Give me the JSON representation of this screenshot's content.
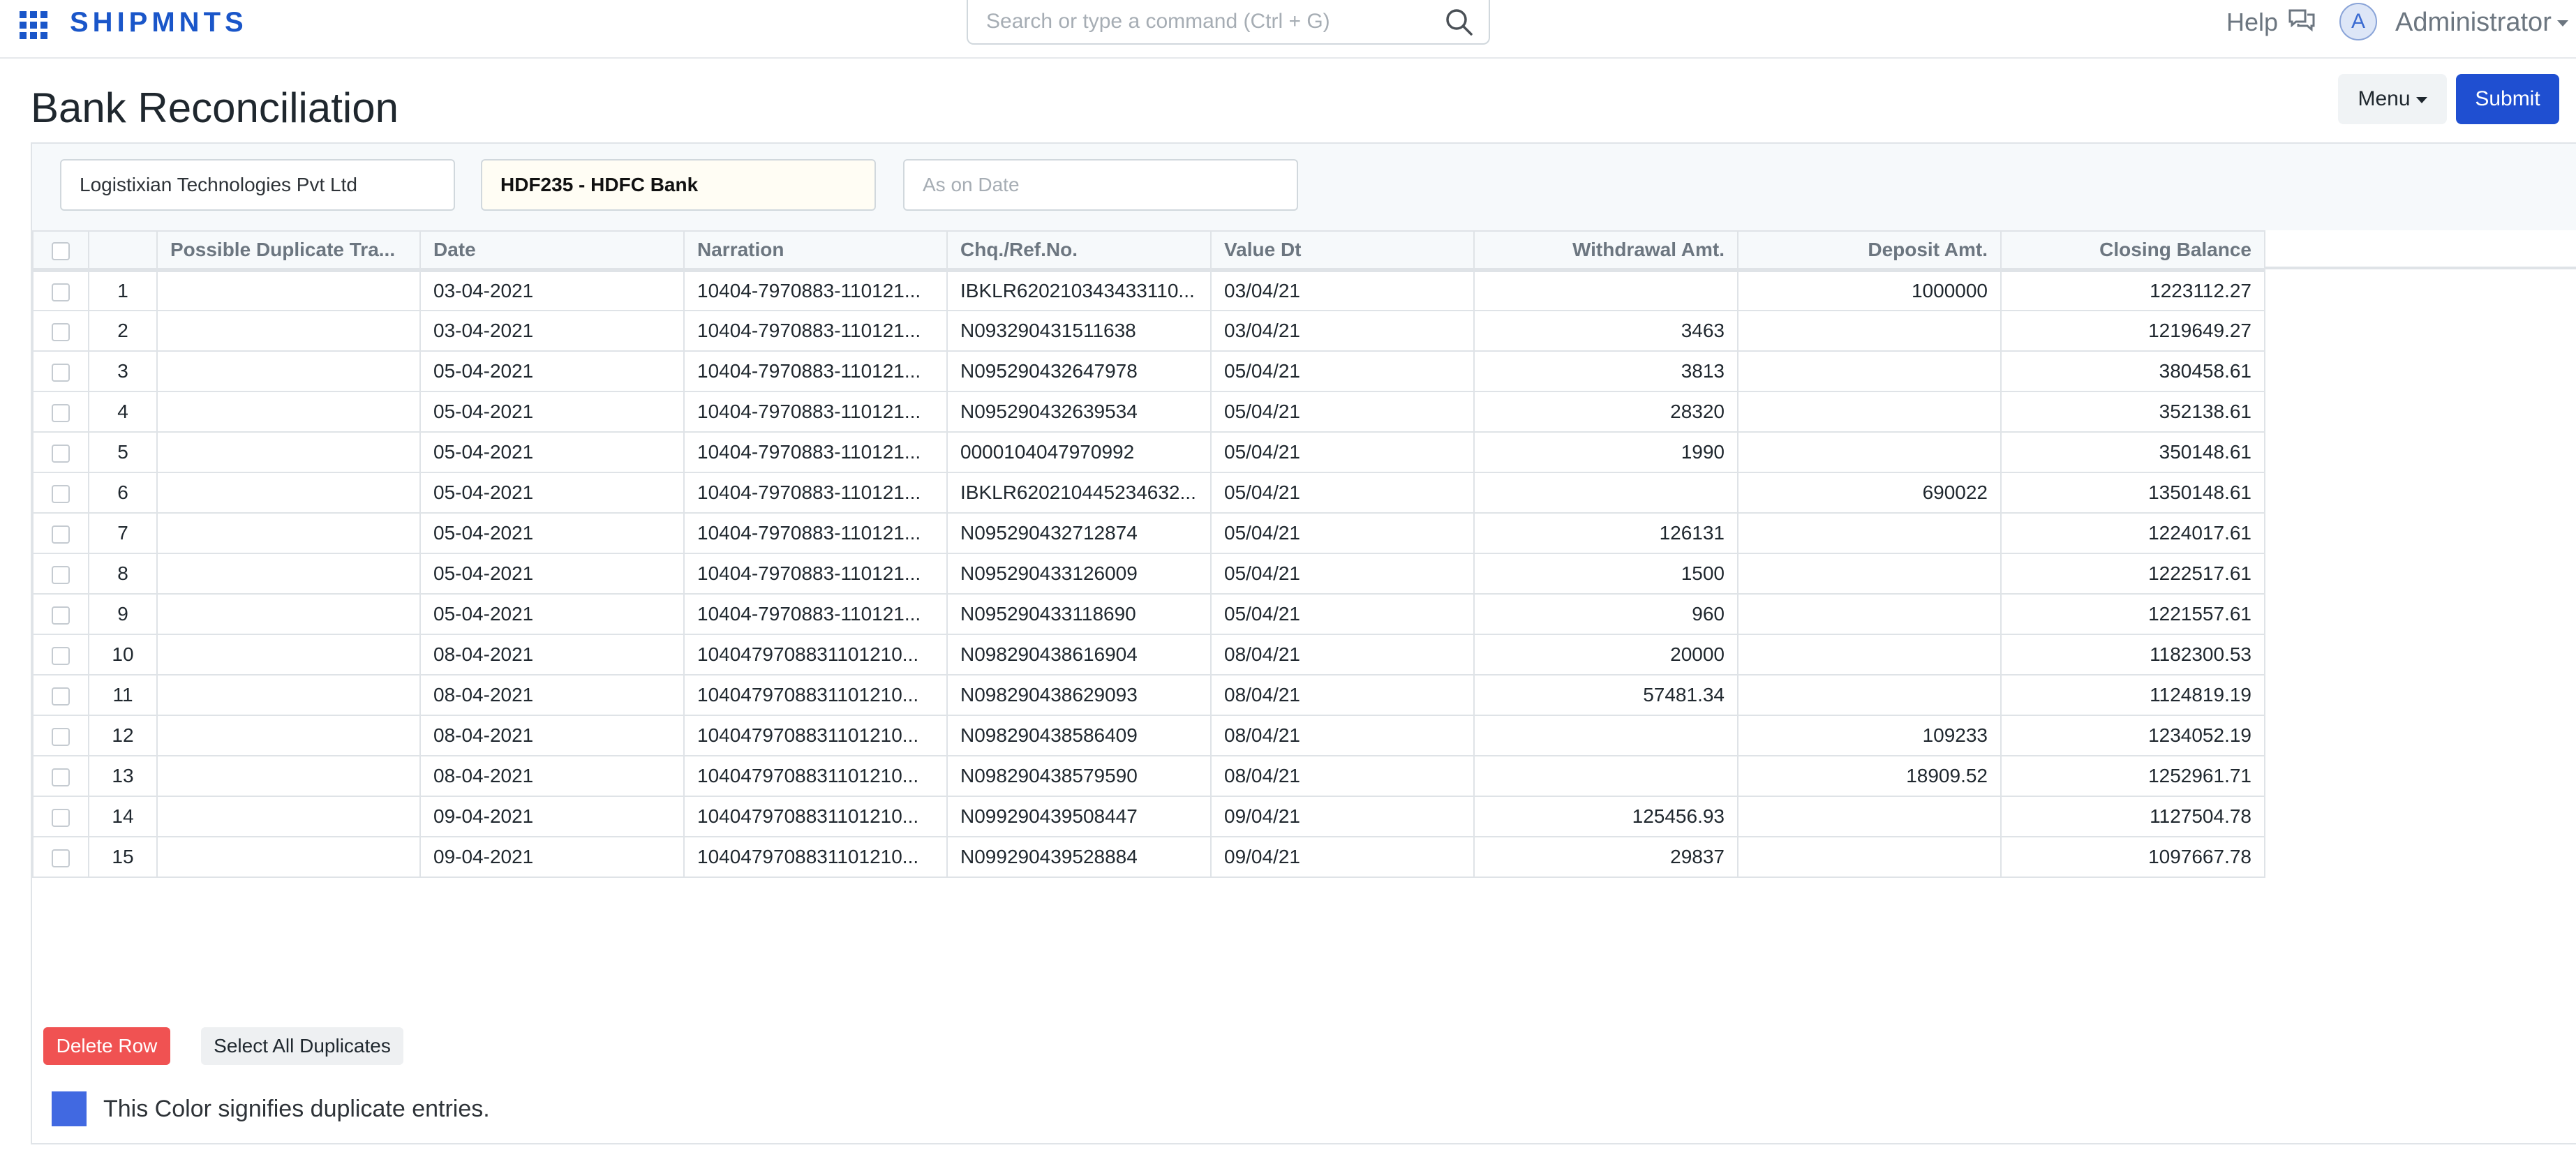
{
  "navbar": {
    "brand": "SHIPMNTS",
    "search_placeholder": "Search or type a command (Ctrl + G)",
    "help_label": "Help",
    "avatar_initial": "A",
    "user_name": "Administrator"
  },
  "page": {
    "title": "Bank Reconciliation",
    "menu_label": "Menu",
    "submit_label": "Submit"
  },
  "filters": {
    "company": "Logistixian Technologies Pvt Ltd",
    "bank_account": "HDF235 - HDFC Bank",
    "date_placeholder": "As on Date"
  },
  "table": {
    "columns": [
      "Possible Duplicate Tra...",
      "Date",
      "Narration",
      "Chq./Ref.No.",
      "Value Dt",
      "Withdrawal Amt.",
      "Deposit Amt.",
      "Closing Balance"
    ],
    "rows": [
      {
        "idx": "1",
        "dup": "",
        "date": "03-04-2021",
        "narration": "10404-7970883-110121...",
        "ref": "IBKLR620210343433110...",
        "value_dt": "03/04/21",
        "withdrawal": "",
        "deposit": "1000000",
        "balance": "1223112.27"
      },
      {
        "idx": "2",
        "dup": "",
        "date": "03-04-2021",
        "narration": "10404-7970883-110121...",
        "ref": "N093290431511638",
        "value_dt": "03/04/21",
        "withdrawal": "3463",
        "deposit": "",
        "balance": "1219649.27"
      },
      {
        "idx": "3",
        "dup": "",
        "date": "05-04-2021",
        "narration": "10404-7970883-110121...",
        "ref": "N095290432647978",
        "value_dt": "05/04/21",
        "withdrawal": "3813",
        "deposit": "",
        "balance": "380458.61"
      },
      {
        "idx": "4",
        "dup": "",
        "date": "05-04-2021",
        "narration": "10404-7970883-110121...",
        "ref": "N095290432639534",
        "value_dt": "05/04/21",
        "withdrawal": "28320",
        "deposit": "",
        "balance": "352138.61"
      },
      {
        "idx": "5",
        "dup": "",
        "date": "05-04-2021",
        "narration": "10404-7970883-110121...",
        "ref": "0000104047970992",
        "value_dt": "05/04/21",
        "withdrawal": "1990",
        "deposit": "",
        "balance": "350148.61"
      },
      {
        "idx": "6",
        "dup": "",
        "date": "05-04-2021",
        "narration": "10404-7970883-110121...",
        "ref": "IBKLR620210445234632...",
        "value_dt": "05/04/21",
        "withdrawal": "",
        "deposit": "690022",
        "balance": "1350148.61"
      },
      {
        "idx": "7",
        "dup": "",
        "date": "05-04-2021",
        "narration": "10404-7970883-110121...",
        "ref": "N095290432712874",
        "value_dt": "05/04/21",
        "withdrawal": "126131",
        "deposit": "",
        "balance": "1224017.61"
      },
      {
        "idx": "8",
        "dup": "",
        "date": "05-04-2021",
        "narration": "10404-7970883-110121...",
        "ref": "N095290433126009",
        "value_dt": "05/04/21",
        "withdrawal": "1500",
        "deposit": "",
        "balance": "1222517.61"
      },
      {
        "idx": "9",
        "dup": "",
        "date": "05-04-2021",
        "narration": "10404-7970883-110121...",
        "ref": "N095290433118690",
        "value_dt": "05/04/21",
        "withdrawal": "960",
        "deposit": "",
        "balance": "1221557.61"
      },
      {
        "idx": "10",
        "dup": "",
        "date": "08-04-2021",
        "narration": "1040479708831101210...",
        "ref": "N098290438616904",
        "value_dt": "08/04/21",
        "withdrawal": "20000",
        "deposit": "",
        "balance": "1182300.53"
      },
      {
        "idx": "11",
        "dup": "",
        "date": "08-04-2021",
        "narration": "1040479708831101210...",
        "ref": "N098290438629093",
        "value_dt": "08/04/21",
        "withdrawal": "57481.34",
        "deposit": "",
        "balance": "1124819.19"
      },
      {
        "idx": "12",
        "dup": "",
        "date": "08-04-2021",
        "narration": "1040479708831101210...",
        "ref": "N098290438586409",
        "value_dt": "08/04/21",
        "withdrawal": "",
        "deposit": "109233",
        "balance": "1234052.19"
      },
      {
        "idx": "13",
        "dup": "",
        "date": "08-04-2021",
        "narration": "1040479708831101210...",
        "ref": "N098290438579590",
        "value_dt": "08/04/21",
        "withdrawal": "",
        "deposit": "18909.52",
        "balance": "1252961.71"
      },
      {
        "idx": "14",
        "dup": "",
        "date": "09-04-2021",
        "narration": "1040479708831101210...",
        "ref": "N099290439508447",
        "value_dt": "09/04/21",
        "withdrawal": "125456.93",
        "deposit": "",
        "balance": "1127504.78"
      },
      {
        "idx": "15",
        "dup": "",
        "date": "09-04-2021",
        "narration": "1040479708831101210...",
        "ref": "N099290439528884",
        "value_dt": "09/04/21",
        "withdrawal": "29837",
        "deposit": "",
        "balance": "1097667.78"
      }
    ]
  },
  "actions": {
    "delete_row_label": "Delete Row",
    "select_duplicates_label": "Select All Duplicates"
  },
  "legend": {
    "text": "This Color signifies duplicate entries.",
    "color": "#4169e1"
  },
  "colors": {
    "brand": "#1a56c9",
    "primary_button": "#1f4fd1",
    "danger_button": "#f05252"
  }
}
